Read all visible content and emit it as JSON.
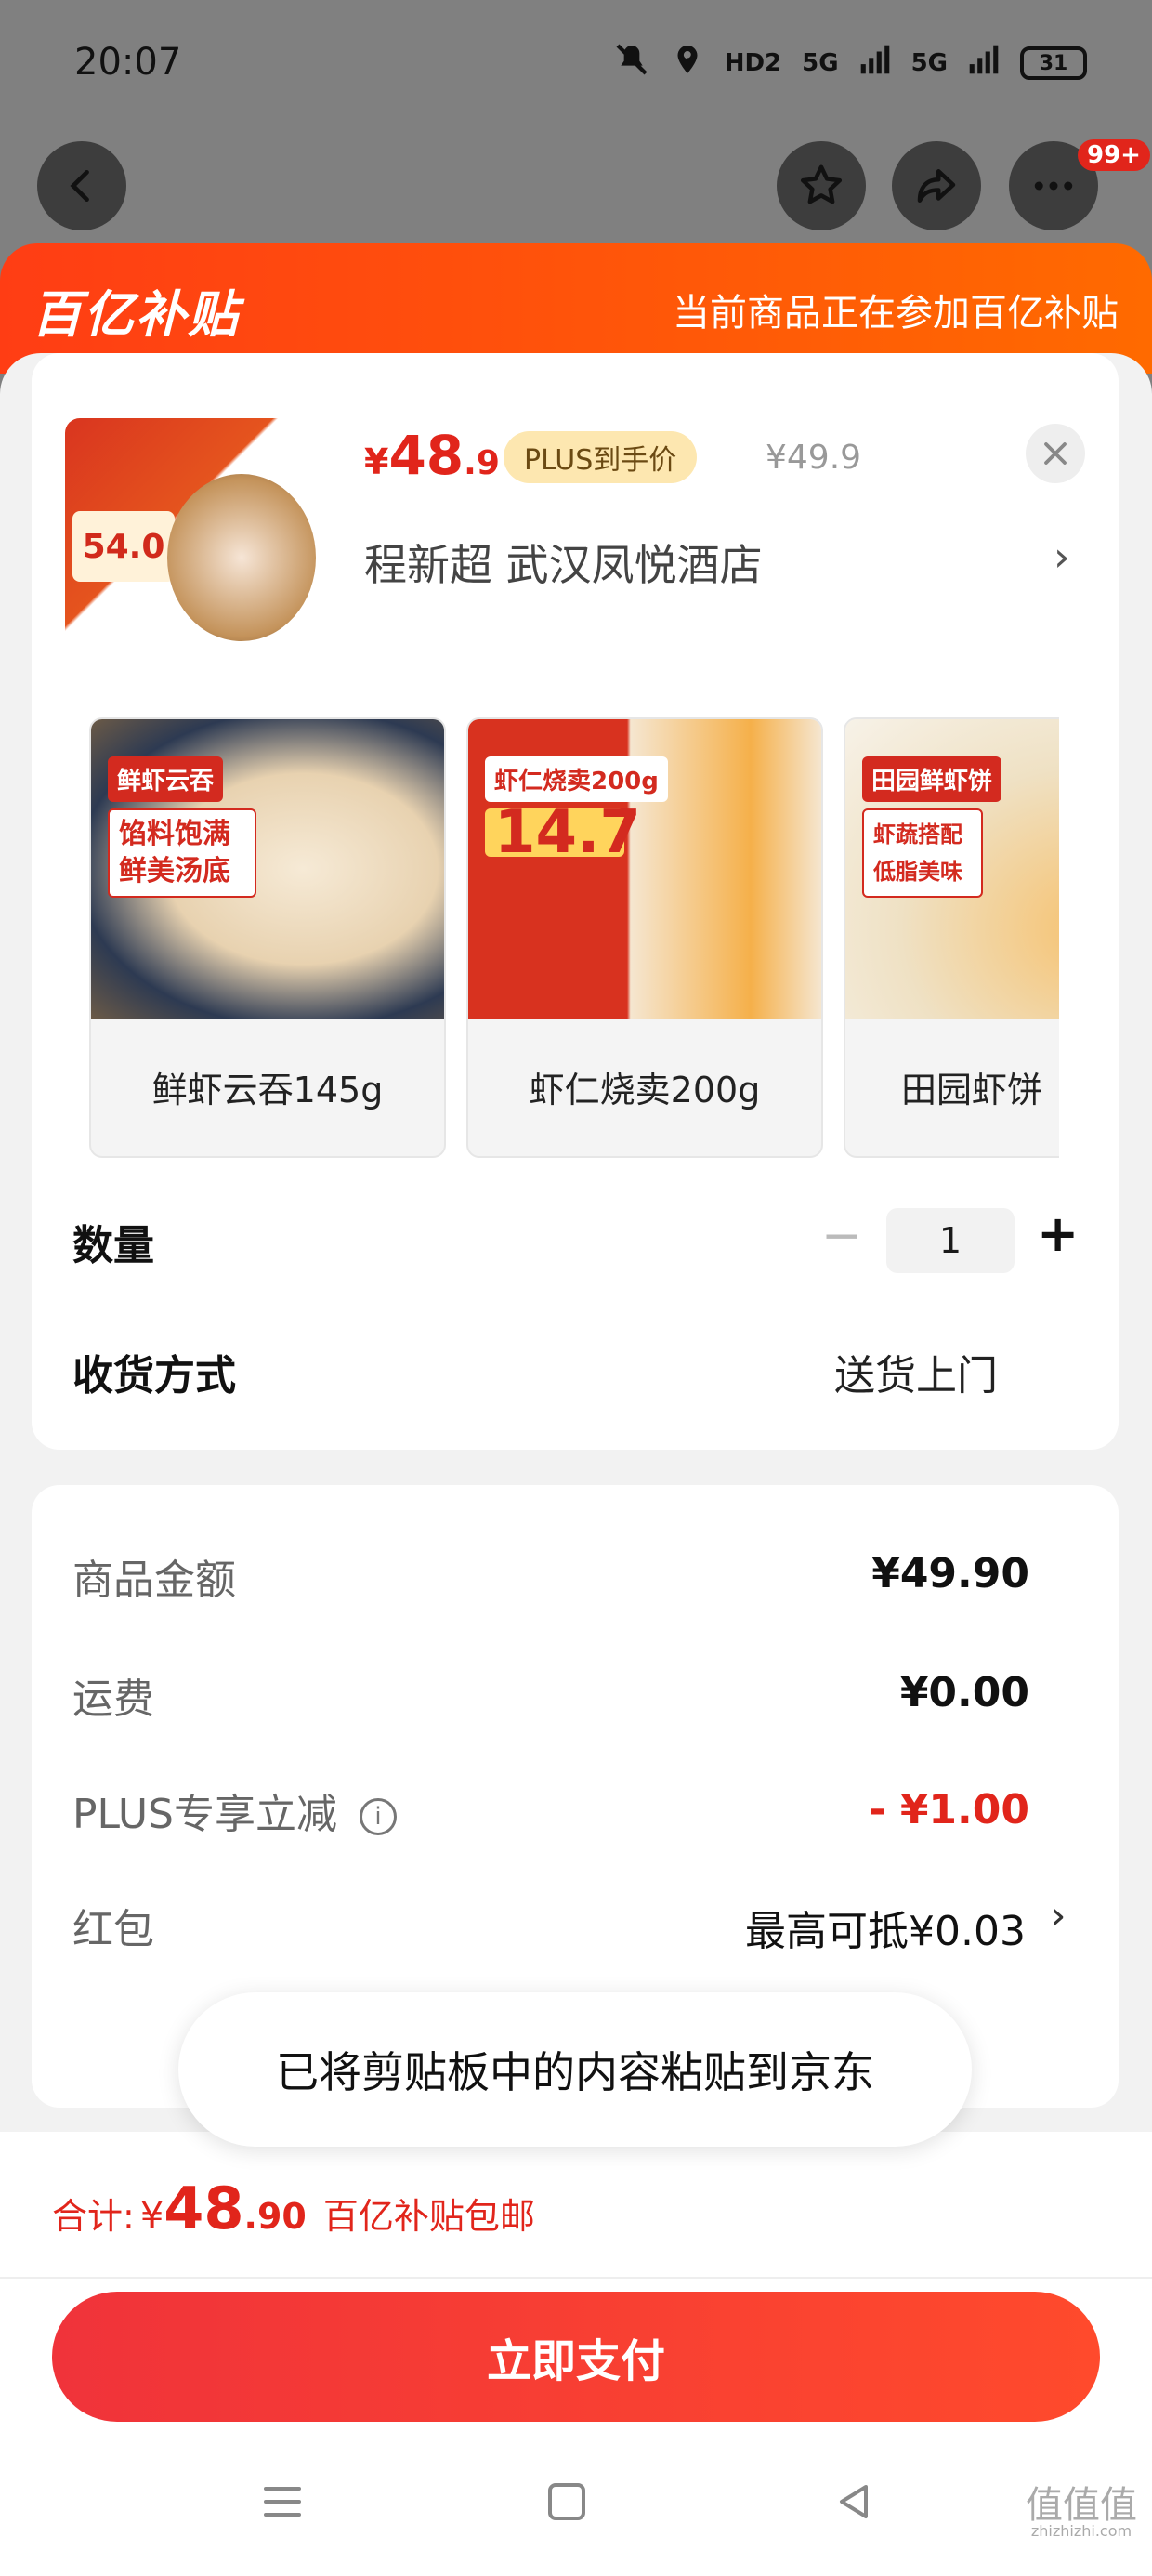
{
  "status_bar": {
    "time": "20:07",
    "hd": "HD2",
    "sig1": "5G",
    "sig2": "5G",
    "battery": "31"
  },
  "top_nav": {
    "badge": "99+"
  },
  "banner": {
    "logo": "百亿补贴",
    "text": "当前商品正在参加百亿补贴"
  },
  "product": {
    "price_currency": "¥",
    "price_int": "48",
    "price_dec": ".9",
    "plus_tag": "PLUS到手价",
    "original_price": "¥49.9",
    "store": "程新超  武汉凤悦酒店",
    "thumb_price": "54.0"
  },
  "variants": [
    {
      "label": "鲜虾云吞145g",
      "tag": "鲜虾云吞",
      "tag2": "馅料饱满鲜美汤底"
    },
    {
      "label": "虾仁烧卖200g",
      "tag": "虾仁烧卖200g",
      "tag2": "14.7"
    },
    {
      "label": "田园虾饼",
      "tag": "田园鲜虾饼",
      "tag2": "虾蔬搭配低脂美味"
    }
  ],
  "quantity": {
    "label": "数量",
    "minus": "−",
    "value": "1",
    "plus": "+"
  },
  "delivery": {
    "label": "收货方式",
    "value": "送货上门"
  },
  "fees": {
    "goods_label": "商品金额",
    "goods_value": "¥49.90",
    "shipping_label": "运费",
    "shipping_value": "¥0.00",
    "plus_label": "PLUS专享立减",
    "plus_value": "- ¥1.00",
    "redpack_label": "红包",
    "redpack_value": "最高可抵¥0.03"
  },
  "toast": "已将剪贴板中的内容粘贴到京东",
  "total": {
    "label": "合计:",
    "yen": "¥",
    "int": "48",
    "dec": ".90",
    "note": "百亿补贴包邮"
  },
  "pay_button": "立即支付",
  "watermark": {
    "main": "值值值",
    "sub": "zhizhizhi.com"
  },
  "colors": {
    "accent": "#e1251b",
    "banner": "#ff4a14",
    "plus_tag_bg": "#fde7b0"
  }
}
